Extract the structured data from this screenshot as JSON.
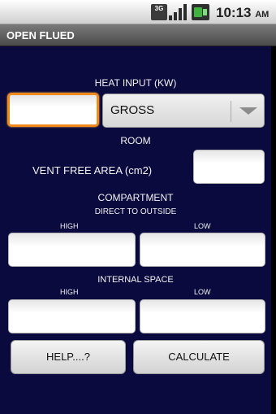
{
  "status_bar": {
    "network_badge": "3G",
    "time": "10:13",
    "ampm": "AM",
    "icons": [
      "network-3g-icon",
      "signal-icon",
      "battery-icon"
    ]
  },
  "title": "OPEN FLUED",
  "heat_input": {
    "label": "HEAT INPUT (KW)",
    "value": "",
    "spinner_selected": "GROSS"
  },
  "room": {
    "label": "ROOM",
    "vent_label": "VENT FREE AREA (cm2)",
    "vent_value": ""
  },
  "compartment": {
    "label": "COMPARTMENT",
    "direct_label": "DIRECT TO OUTSIDE",
    "high_label": "HIGH",
    "low_label": "LOW",
    "direct_high_value": "",
    "direct_low_value": "",
    "internal_label": "INTERNAL SPACE",
    "internal_high_label": "HIGH",
    "internal_low_label": "LOW",
    "internal_high_value": "",
    "internal_low_value": ""
  },
  "buttons": {
    "help": "HELP....?",
    "calculate": "CALCULATE"
  },
  "colors": {
    "background": "#0a0a3e",
    "focus": "#f08a1c"
  }
}
